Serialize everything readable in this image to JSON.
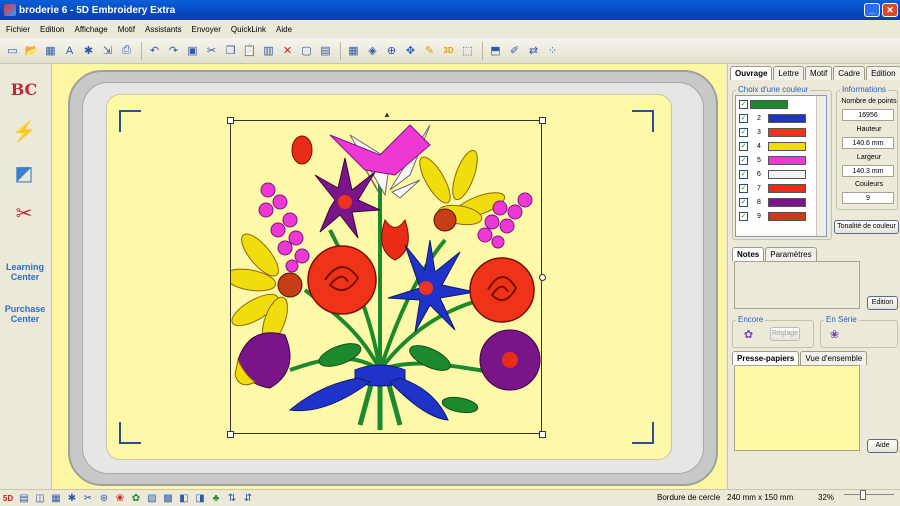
{
  "window": {
    "title": "broderie 6 - 5D Embroidery Extra",
    "min": "_",
    "close": "✕"
  },
  "menu": [
    "Fichier",
    "Edition",
    "Affichage",
    "Motif",
    "Assistants",
    "Envoyer",
    "QuickLink",
    "Aide"
  ],
  "toolbar_icons": [
    "new-icon",
    "open-icon",
    "save-icon",
    "text-icon",
    "wizard-icon",
    "export-icon",
    "undo-icon",
    "redo-icon",
    "select-box-icon",
    "cut-icon",
    "copy-icon",
    "paste-icon",
    "book-icon",
    "delete-icon",
    "frame-icon",
    "window-icon",
    "grid-icon",
    "fill-icon",
    "zoom-icon",
    "move-icon",
    "ruler-icon",
    "3d-icon",
    "view-icon",
    "select-icon",
    "edit-icon",
    "stitch-icon",
    "points-icon"
  ],
  "left_panel": {
    "learning_center": "Learning Center",
    "purchase_center": "Purchase Center"
  },
  "right_panel": {
    "tabs": [
      "Ouvrage",
      "Lettre",
      "Motif",
      "Cadre",
      "Edition"
    ],
    "active_tab": "Ouvrage",
    "color_group_title": "Choix d'une couleur",
    "colors": [
      {
        "num": "1",
        "hex": "#1c8a2c"
      },
      {
        "num": "2",
        "hex": "#1f33c9"
      },
      {
        "num": "3",
        "hex": "#ee3318"
      },
      {
        "num": "4",
        "hex": "#f1dd0e"
      },
      {
        "num": "5",
        "hex": "#ee38d4"
      },
      {
        "num": "6",
        "hex": "#f3f3f3"
      },
      {
        "num": "7",
        "hex": "#e92c18"
      },
      {
        "num": "8",
        "hex": "#7a1489"
      },
      {
        "num": "9",
        "hex": "#c63d18"
      }
    ],
    "info": {
      "title": "Informations",
      "points_label": "Nombre de points",
      "points": "16956",
      "height_label": "Hauteur",
      "height": "140.6 mm",
      "width_label": "Largeur",
      "width": "140.3 mm",
      "colors_label": "Couleurs",
      "colors": "9"
    },
    "tone_button": "Tonalité de couleur",
    "notes_tabs": [
      "Notes",
      "Paramètres"
    ],
    "edit_button": "Edition",
    "encore_label": "Encore",
    "reglage_button": "Réglage",
    "enserie_label": "En Série",
    "clipboard_tabs": [
      "Presse-papiers",
      "Vue d'ensemble"
    ],
    "help_button": "Aide"
  },
  "status": {
    "hoop": "Bordure de cercle",
    "size": "240 mm x 150 mm",
    "zoom": "32%"
  }
}
